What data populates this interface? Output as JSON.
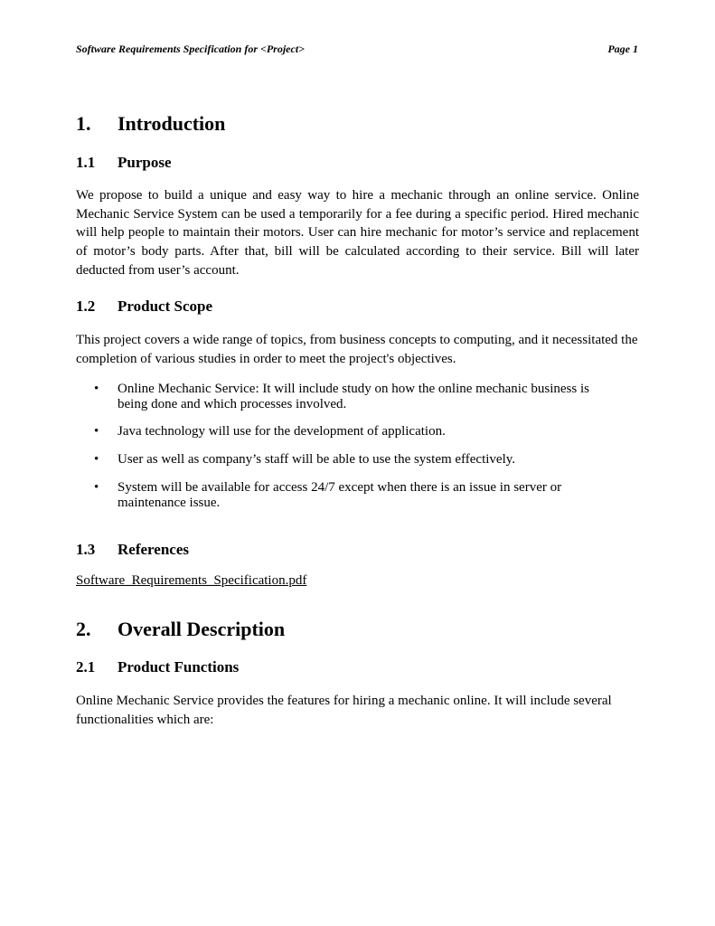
{
  "header": {
    "title": "Software Requirements Specification for <Project>",
    "page": "Page 1"
  },
  "sections": {
    "introduction": {
      "number": "1.",
      "title": "Introduction",
      "purpose": {
        "number": "1.1",
        "title": "Purpose",
        "text": "We propose to build a unique and easy way to hire a mechanic through an online service. Online Mechanic Service System can be used a temporarily for a fee during a specific period. Hired mechanic will help people to maintain their motors. User can hire mechanic for motor’s service and replacement of motor’s body parts. After that, bill will be calculated according to their service. Bill will later deducted from user’s account."
      },
      "scope": {
        "number": "1.2",
        "title": "Product Scope",
        "text": "This project covers a wide range of topics, from business concepts to computing, and it necessitated the completion of various studies in order to meet the project's objectives.",
        "bullets": [
          "Online Mechanic Service: It will include study on how the online mechanic business is being done and which processes involved.",
          "Java technology will use for the development of application.",
          "User as well as company’s staff will be able to use the system effectively.",
          "System will be available for access 24/7 except when there is an issue in server or maintenance issue."
        ]
      },
      "references": {
        "number": "1.3",
        "title": "References",
        "link": "Software_Requirements_Specification.pdf"
      }
    },
    "overall": {
      "number": "2.",
      "title": "Overall Description",
      "functions": {
        "number": "2.1",
        "title": "Product Functions",
        "text": "Online Mechanic Service provides the features for hiring a mechanic online. It will include several functionalities which are:"
      }
    }
  }
}
